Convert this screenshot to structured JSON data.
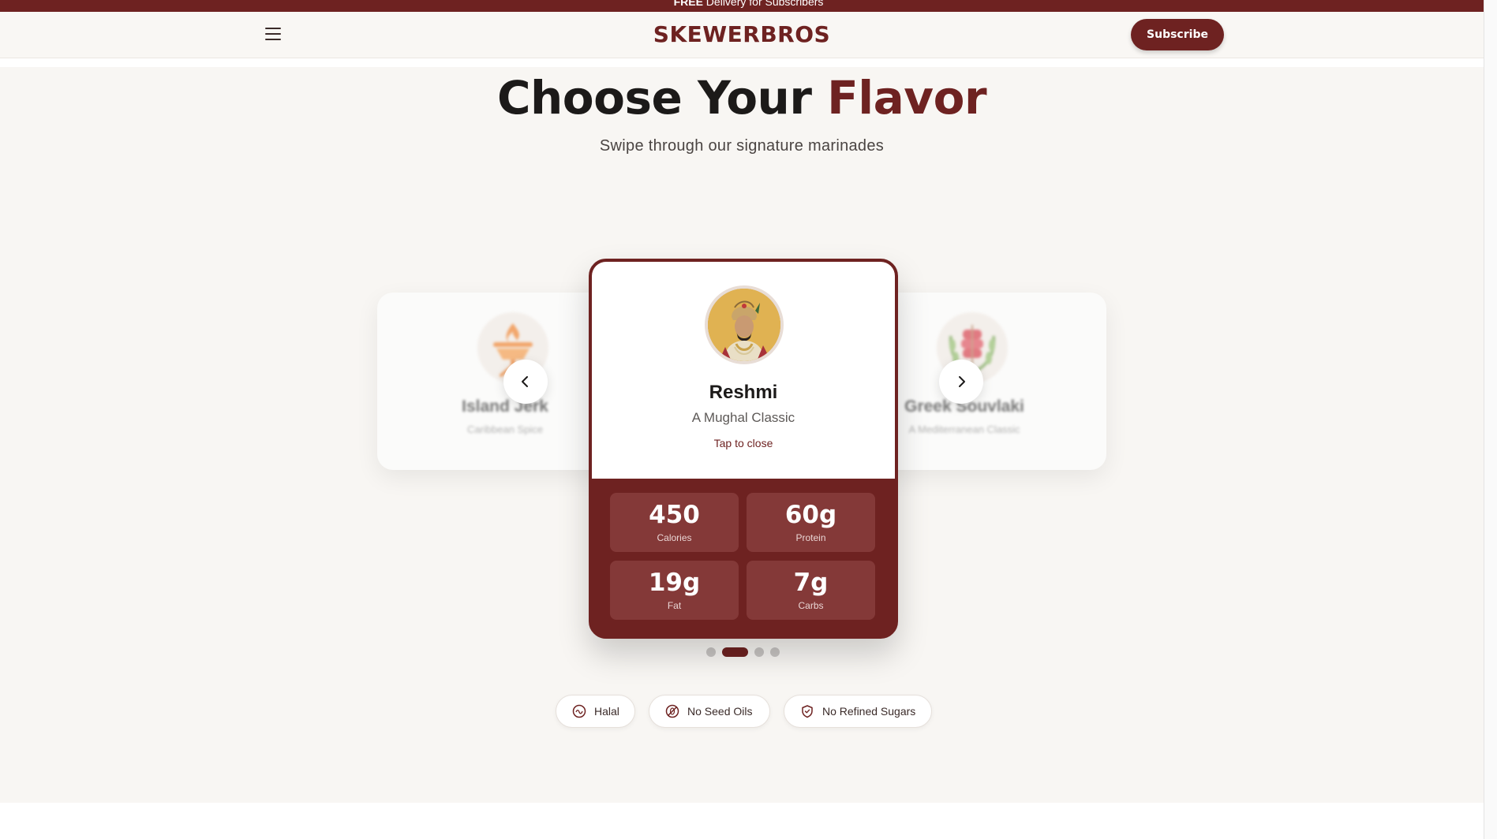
{
  "promo": {
    "bold": "FREE",
    "text": " Delivery for Subscribers"
  },
  "header": {
    "brand": "SKEWERBROS",
    "subscribe_label": "Subscribe",
    "menu_icon": "hamburger-menu-icon"
  },
  "hero": {
    "title_main": "Choose Your ",
    "title_accent": "Flavor",
    "subtitle": "Swipe through our signature marinades"
  },
  "carousel": {
    "prev_card": {
      "name": "Island Jerk",
      "sub": "Caribbean Spice",
      "icon": "grill-flame-icon"
    },
    "current_card": {
      "name": "Reshmi",
      "sub": "A Mughal Classic",
      "tap_label": "Tap to close",
      "image": "mughal-emperor-portrait",
      "stats": [
        {
          "value": "450",
          "label": "Calories"
        },
        {
          "value": "60g",
          "label": "Protein"
        },
        {
          "value": "19g",
          "label": "Fat"
        },
        {
          "value": "7g",
          "label": "Carbs"
        }
      ]
    },
    "next_card": {
      "name": "Greek Souvlaki",
      "sub": "A Mediterranean Classic",
      "icon": "olive-wreath-icon"
    },
    "pagination": {
      "total": 4,
      "active_index": 1
    }
  },
  "badges": [
    {
      "label": "Halal",
      "icon": "halal-icon"
    },
    {
      "label": "No Seed Oils",
      "icon": "no-seed-oil-icon"
    },
    {
      "label": "No Refined Sugars",
      "icon": "shield-check-icon"
    }
  ],
  "colors": {
    "brand": "#6e2221",
    "stat_tile": "#843938",
    "background": "#f8f6f3"
  }
}
